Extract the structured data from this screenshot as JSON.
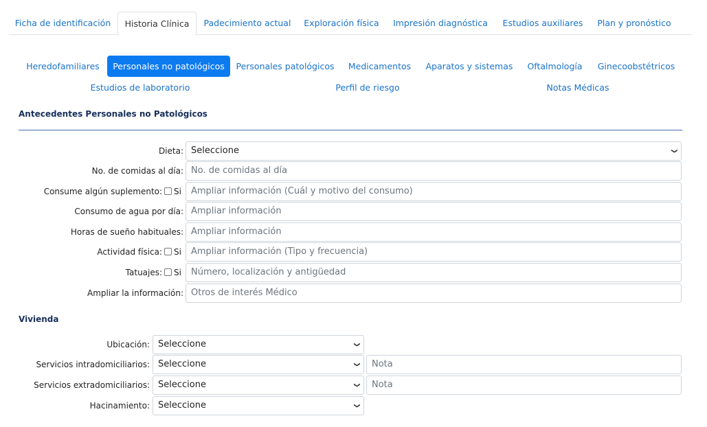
{
  "top_tabs": [
    {
      "label": "Ficha de identificación"
    },
    {
      "label": "Historia Clínica"
    },
    {
      "label": "Padecimiento actual"
    },
    {
      "label": "Exploración física"
    },
    {
      "label": "Impresión diagnóstica"
    },
    {
      "label": "Estudios auxiliares"
    },
    {
      "label": "Plan y pronóstico"
    }
  ],
  "sub_tabs": [
    {
      "label": "Heredofamiliares"
    },
    {
      "label": "Personales no patológicos"
    },
    {
      "label": "Personales patológicos"
    },
    {
      "label": "Medicamentos"
    },
    {
      "label": "Aparatos y sistemas"
    },
    {
      "label": "Oftalmología"
    },
    {
      "label": "Ginecoobstétricos"
    },
    {
      "label": "Estudios de laboratorio"
    },
    {
      "label": "Perfil de riesgo"
    },
    {
      "label": "Notas Médicas"
    }
  ],
  "antecedentes": {
    "title": "Antecedentes Personales no Patológicos",
    "dieta": {
      "label": "Dieta:",
      "value": "Seleccione"
    },
    "comidas": {
      "label": "No. de comidas al día:",
      "placeholder": "No. de comidas al día"
    },
    "suplemento": {
      "label": "Consume algún suplemento:",
      "check": "Si",
      "placeholder": "Ampliar información (Cuál y motivo del consumo)"
    },
    "agua": {
      "label": "Consumo de agua por día:",
      "placeholder": "Ampliar información"
    },
    "sueno": {
      "label": "Horas de sueño habituales:",
      "placeholder": "Ampliar información"
    },
    "actividad": {
      "label": "Actividad física:",
      "check": "Si",
      "placeholder": "Ampliar información (Tipo y frecuencia)"
    },
    "tatuajes": {
      "label": "Tatuajes:",
      "check": "Si",
      "placeholder": "Número, localización y antigüedad"
    },
    "ampliar": {
      "label": "Ampliar la información:",
      "placeholder": "Otros de interés Médico"
    }
  },
  "vivienda": {
    "title": "Vivienda",
    "ubicacion": {
      "label": "Ubicación:",
      "value": "Seleccione"
    },
    "intra": {
      "label": "Servicios intradomiciliarios:",
      "value": "Seleccione",
      "note_placeholder": "Nota"
    },
    "extra": {
      "label": "Servicios extradomiciliarios:",
      "value": "Seleccione",
      "note_placeholder": "Nota"
    },
    "hacinamiento": {
      "label": "Hacinamiento:",
      "value": "Seleccione"
    }
  },
  "colors": {
    "accent": "#0d7bf0",
    "link": "#1a73c8",
    "heading": "#17305a"
  }
}
